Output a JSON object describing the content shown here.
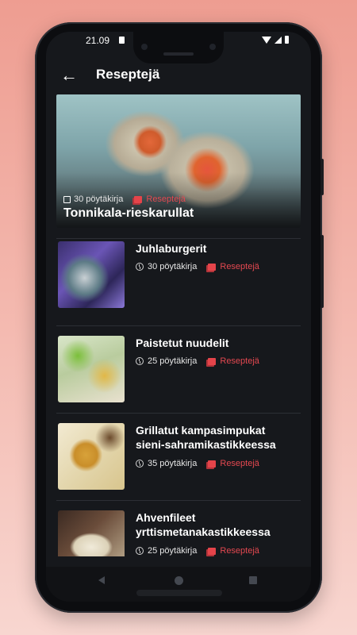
{
  "status_bar": {
    "time": "21.09"
  },
  "app_bar": {
    "back_icon": "arrow-left-icon",
    "title": "Reseptejä"
  },
  "featured": {
    "title": "Tonnikala-rieskarullat",
    "count": "30 pöytäkirja",
    "category": "Reseptejä"
  },
  "recipes": [
    {
      "title_line1": "Juhlaburgerit",
      "title_line2": "",
      "count": "30 pöytäkirja",
      "category": "Reseptejä"
    },
    {
      "title_line1": "Paistetut nuudelit",
      "title_line2": "",
      "count": "25 pöytäkirja",
      "category": "Reseptejä"
    },
    {
      "title_line1": "Grillatut kampasimpukat",
      "title_line2": "sieni-sahramikastikkeessa",
      "count": "35 pöytäkirja",
      "category": "Reseptejä"
    },
    {
      "title_line1": "Ahvenfileet",
      "title_line2": "yrttismetanakastikkeessa",
      "count": "25 pöytäkirja",
      "category": "Reseptejä"
    }
  ],
  "colors": {
    "background": "#16181c",
    "accent": "#e34850",
    "text": "#ffffff",
    "divider": "#2c2f35"
  }
}
